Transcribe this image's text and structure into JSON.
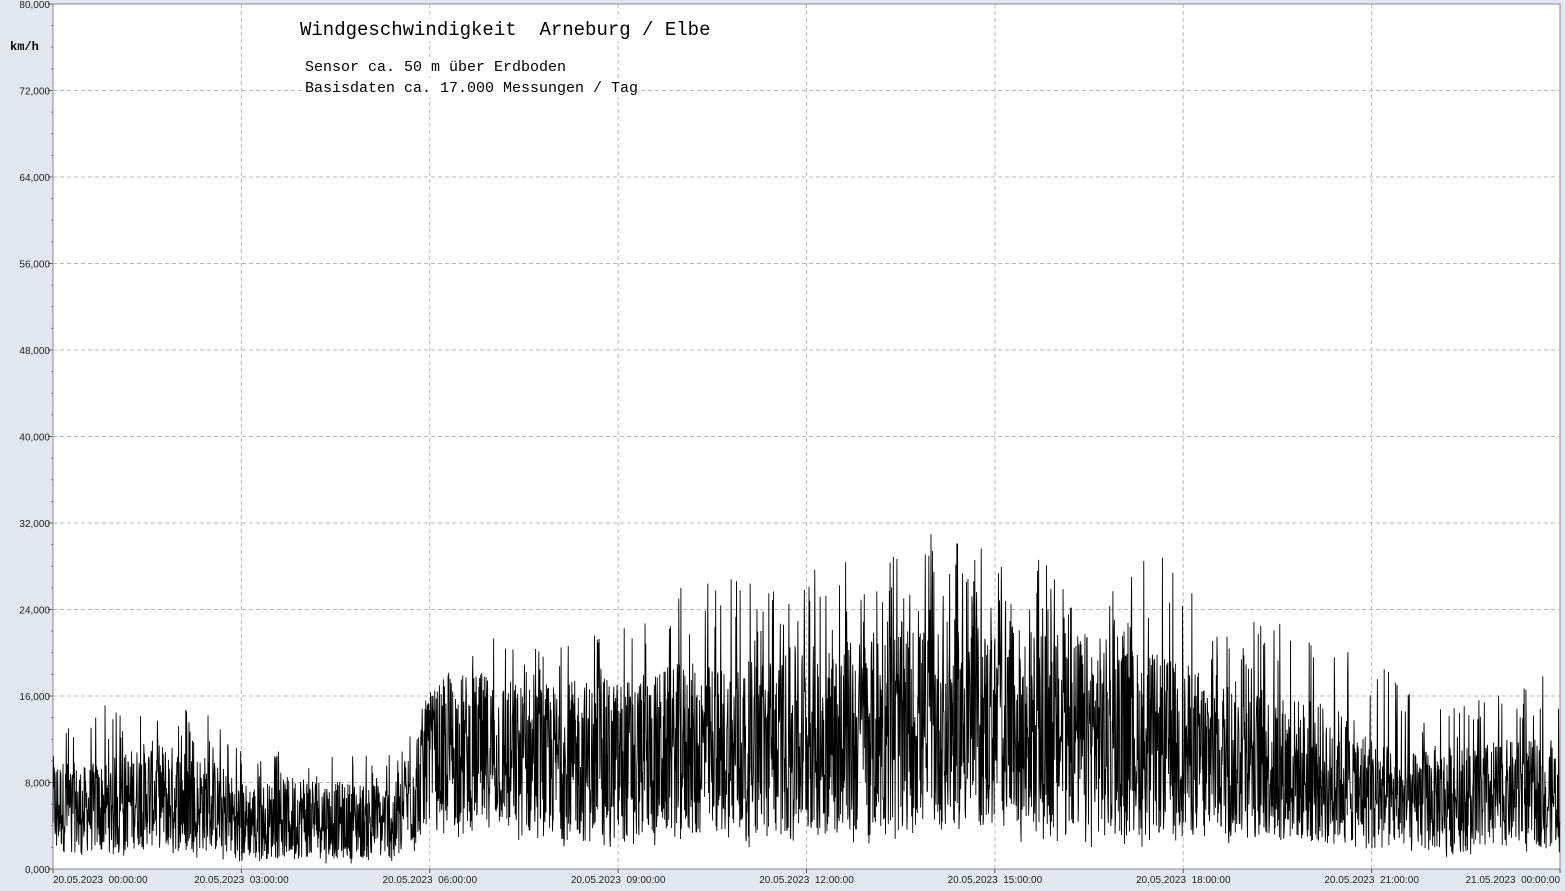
{
  "chart_data": {
    "type": "line",
    "title": "Windgeschwindigkeit  Arneburg / Elbe",
    "subtitle_lines": [
      "Sensor ca. 50 m über Erdboden",
      "Basisdaten ca. 17.000 Messungen / Tag"
    ],
    "ylabel": "km/h",
    "ylim": [
      0,
      80
    ],
    "y_ticks": [
      "0,000",
      "8,000",
      "16,000",
      "24,000",
      "32,000",
      "40,000",
      "48,000",
      "56,000",
      "64,000",
      "72,000",
      "80,000"
    ],
    "xlim_hours": [
      0,
      24
    ],
    "x_ticks": [
      "20.05.2023  00:00:00",
      "20.05.2023  03:00:00",
      "20.05.2023  06:00:00",
      "20.05.2023  09:00:00",
      "20.05.2023  12:00:00",
      "20.05.2023  15:00:00",
      "20.05.2023  18:00:00",
      "20.05.2023  21:00:00",
      "21.05.2023  00:00:00"
    ],
    "grid": true,
    "series": [
      {
        "color": "#000000",
        "x_hours": [
          0,
          0.5,
          1,
          1.5,
          2,
          2.5,
          3,
          3.5,
          4,
          4.5,
          5,
          5.5,
          6,
          6.5,
          7,
          7.5,
          8,
          8.5,
          9,
          9.5,
          10,
          10.5,
          11,
          11.5,
          12,
          12.5,
          13,
          13.5,
          14,
          14.5,
          15,
          15.5,
          16,
          16.5,
          17,
          17.5,
          18,
          18.5,
          19,
          19.5,
          20,
          20.5,
          21,
          21.5,
          22,
          22.5,
          23,
          23.5,
          24
        ],
        "mean": [
          6,
          5.5,
          6,
          7,
          6.5,
          6,
          4.5,
          4.5,
          5,
          4.5,
          4.5,
          4.5,
          10.5,
          11,
          11,
          10,
          10,
          10,
          10,
          10.5,
          11,
          11,
          11,
          11.5,
          12,
          12,
          12.5,
          13,
          13,
          13.5,
          13,
          13,
          12.5,
          12.5,
          12,
          11.5,
          11,
          10.5,
          10,
          9.5,
          9,
          8.5,
          7,
          6,
          6.5,
          6.5,
          7,
          7,
          7
        ],
        "max": [
          13,
          15.5,
          15,
          17,
          15,
          15,
          11,
          11,
          11,
          11,
          10.5,
          11,
          17,
          20,
          22,
          20,
          24,
          22,
          22,
          25,
          28,
          29,
          27,
          28,
          28,
          29,
          29,
          30,
          31,
          30,
          30,
          29,
          28,
          27,
          26,
          30,
          27,
          24,
          23,
          24,
          22,
          21,
          20,
          17,
          16,
          16,
          16,
          18,
          18
        ],
        "min": [
          1,
          1,
          1,
          1.5,
          1,
          1,
          0.5,
          0.5,
          0.5,
          0.5,
          0.5,
          0.5,
          2,
          3,
          3,
          2,
          2,
          1.5,
          1.5,
          2,
          2,
          2,
          2,
          2,
          2,
          2,
          2,
          2,
          2.5,
          2.5,
          2.5,
          2.5,
          2,
          2,
          2,
          2,
          2,
          2,
          2,
          2,
          1.5,
          1.5,
          1,
          1,
          1,
          1,
          1.5,
          1.5,
          1.5
        ]
      }
    ]
  }
}
